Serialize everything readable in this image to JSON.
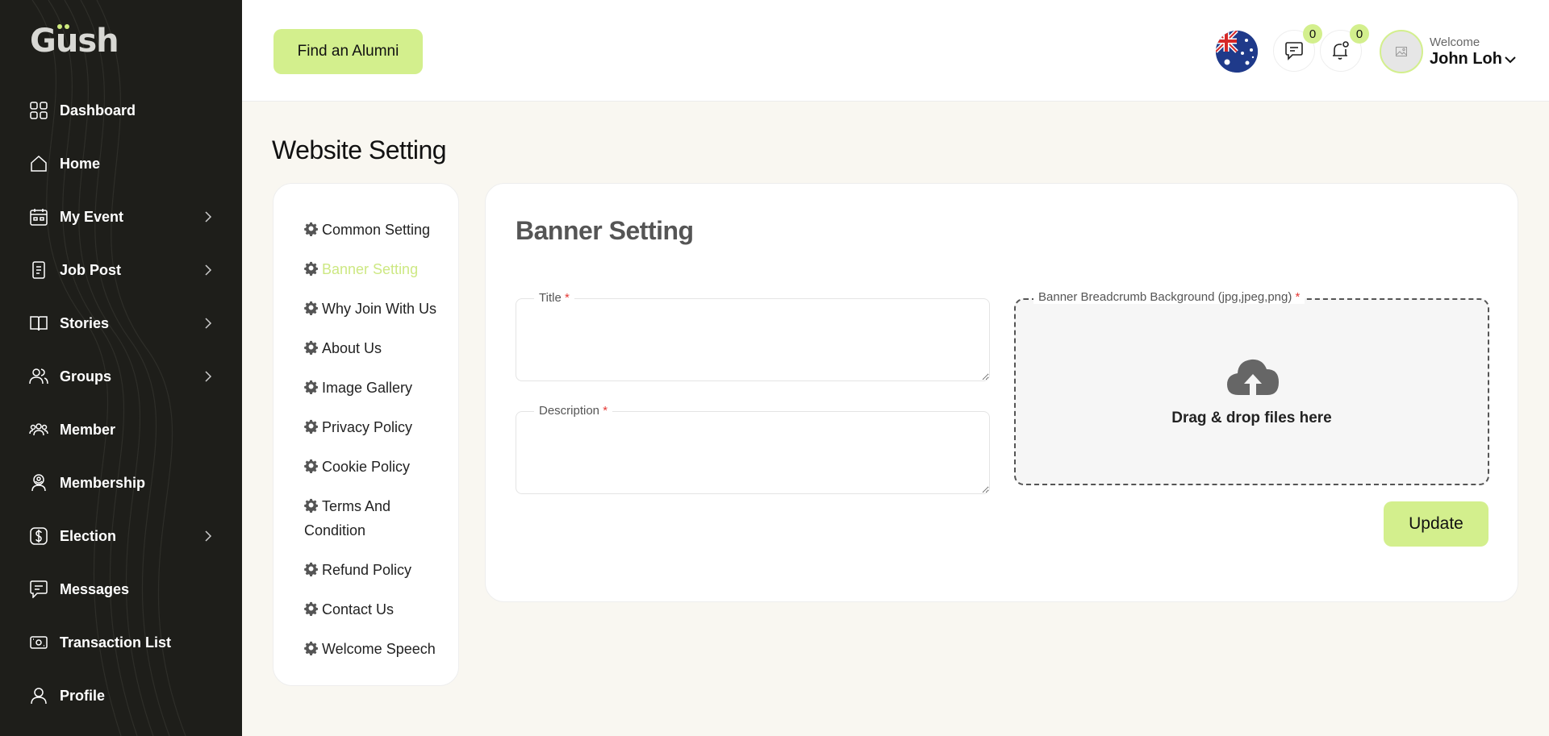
{
  "sidebar": {
    "logo": "Gush",
    "items": [
      {
        "label": "Dashboard",
        "icon": "grid-icon",
        "has_submenu": false
      },
      {
        "label": "Home",
        "icon": "home-icon",
        "has_submenu": false
      },
      {
        "label": "My Event",
        "icon": "calendar-icon",
        "has_submenu": true
      },
      {
        "label": "Job Post",
        "icon": "document-icon",
        "has_submenu": true
      },
      {
        "label": "Stories",
        "icon": "book-icon",
        "has_submenu": true
      },
      {
        "label": "Groups",
        "icon": "users-icon",
        "has_submenu": true
      },
      {
        "label": "Member",
        "icon": "members-icon",
        "has_submenu": false
      },
      {
        "label": "Membership",
        "icon": "badge-icon",
        "has_submenu": false
      },
      {
        "label": "Election",
        "icon": "dollar-icon",
        "has_submenu": true
      },
      {
        "label": "Messages",
        "icon": "chat-icon",
        "has_submenu": false
      },
      {
        "label": "Transaction List",
        "icon": "cash-icon",
        "has_submenu": false
      },
      {
        "label": "Profile",
        "icon": "user-icon",
        "has_submenu": false
      }
    ]
  },
  "header": {
    "find_alumni_label": "Find an Alumni",
    "language_flag": "australia-flag-icon",
    "messages_count": "0",
    "notifications_count": "0",
    "welcome_text": "Welcome",
    "user_name": "John Loh"
  },
  "page": {
    "title": "Website Setting"
  },
  "settings_menu": {
    "items": [
      {
        "label": "Common Setting",
        "active": false
      },
      {
        "label": "Banner Setting",
        "active": true
      },
      {
        "label": "Why Join With Us",
        "active": false
      },
      {
        "label": "About Us",
        "active": false
      },
      {
        "label": "Image Gallery",
        "active": false
      },
      {
        "label": "Privacy Policy",
        "active": false
      },
      {
        "label": "Cookie Policy",
        "active": false
      },
      {
        "label": "Terms And Condition",
        "active": false
      },
      {
        "label": "Refund Policy",
        "active": false
      },
      {
        "label": "Contact Us",
        "active": false
      },
      {
        "label": "Welcome Speech",
        "active": false
      }
    ]
  },
  "banner_form": {
    "title": "Banner Setting",
    "title_field": {
      "label": "Title",
      "required_mark": "*",
      "value": ""
    },
    "description_field": {
      "label": "Description",
      "required_mark": "*",
      "value": ""
    },
    "upload": {
      "label": "Banner Breadcrumb Background (jpg,jpeg,png)",
      "required_mark": "*",
      "hint": "Drag & drop files here"
    },
    "update_label": "Update"
  },
  "colors": {
    "sidebar_bg": "#1e1e1a",
    "accent": "#d3ef8d",
    "active_menu_text": "#cde883",
    "page_bg": "#f9f7f1",
    "required": "#e53935"
  }
}
